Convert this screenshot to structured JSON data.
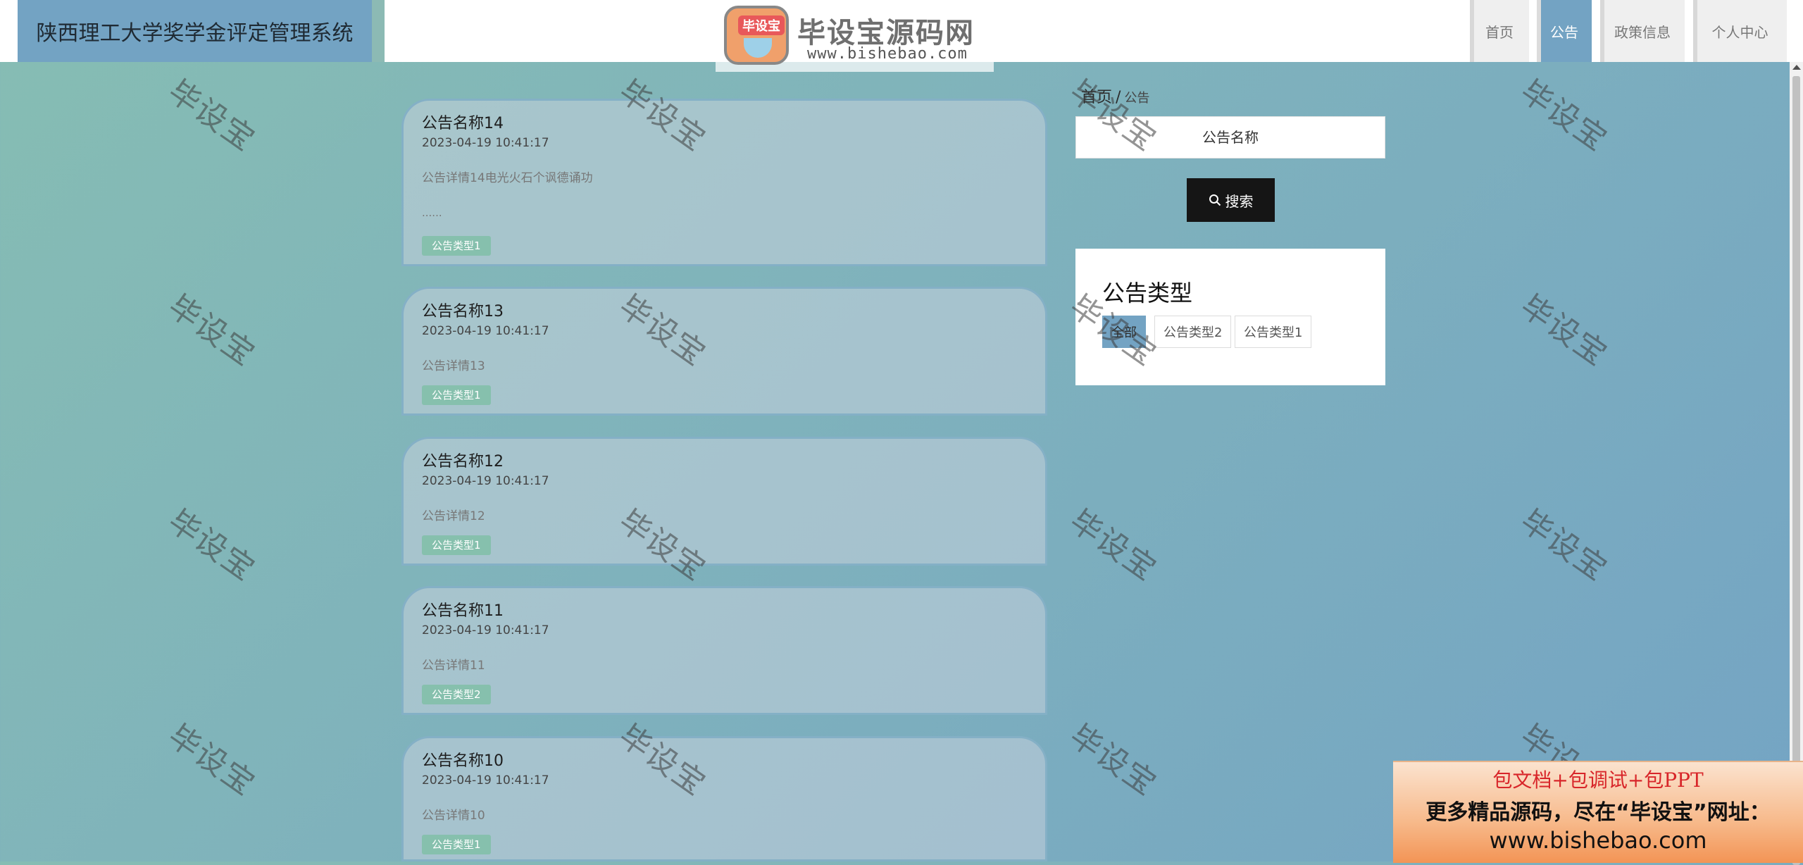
{
  "header": {
    "system_title": "陕西理工大学奖学金评定管理系统",
    "logo": {
      "badge_text": "毕设宝",
      "main_text": "毕设宝源码网",
      "sub_text": "www.bishebao.com"
    },
    "nav": [
      {
        "label": "首页",
        "active": false
      },
      {
        "label": "公告",
        "active": true
      },
      {
        "label": "政策信息",
        "active": false
      },
      {
        "label": "个人中心",
        "active": false
      }
    ]
  },
  "notices": [
    {
      "title": "公告名称14",
      "time": "2023-04-19 10:41:17",
      "detail": "公告详情14电光火石个讽德诵功",
      "ellipsis": "......",
      "type": "公告类型1"
    },
    {
      "title": "公告名称13",
      "time": "2023-04-19 10:41:17",
      "detail": "公告详情13",
      "type": "公告类型1"
    },
    {
      "title": "公告名称12",
      "time": "2023-04-19 10:41:17",
      "detail": "公告详情12",
      "type": "公告类型1"
    },
    {
      "title": "公告名称11",
      "time": "2023-04-19 10:41:17",
      "detail": "公告详情11",
      "type": "公告类型2"
    },
    {
      "title": "公告名称10",
      "time": "2023-04-19 10:41:17",
      "detail": "公告详情10",
      "type": "公告类型1"
    }
  ],
  "sidebar": {
    "breadcrumb": {
      "home": "首页",
      "separator": "/",
      "current": "公告"
    },
    "search": {
      "placeholder": "公告名称",
      "value": "",
      "button_label": "搜索",
      "button_icon": "search-icon"
    },
    "type_filter": {
      "title": "公告类型",
      "options": [
        {
          "label": "全部",
          "active": true
        },
        {
          "label": "公告类型2",
          "active": false
        },
        {
          "label": "公告类型1",
          "active": false
        }
      ]
    }
  },
  "watermark": {
    "text": "毕设宝"
  },
  "ad": {
    "line1": "包文档+包调试+包PPT",
    "line2": "更多精品源码，尽在“毕设宝”网址：",
    "line3": "www.bishebao.com"
  },
  "colors": {
    "accent": "#73a3c3",
    "tag": "#86c0ad",
    "search_button": "#151515",
    "background_start": "#86bdb3",
    "background_end": "#74a4c4"
  }
}
